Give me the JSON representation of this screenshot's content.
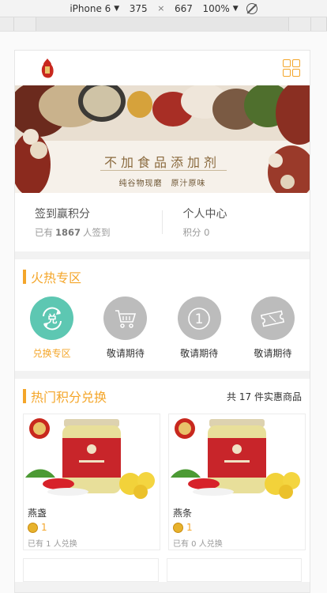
{
  "devtools": {
    "device": "iPhone 6",
    "width": "375",
    "height": "667",
    "zoom": "100%"
  },
  "banner": {
    "slogan": "不加食品添加剂",
    "subtitle": "纯谷物现磨　原汁原味"
  },
  "stats": {
    "checkin_title": "签到赢积分",
    "checkin_prefix": "已有",
    "checkin_count": "1867",
    "checkin_suffix": "人签到",
    "profile_title": "个人中心",
    "points_label": "积分",
    "points_value": "0"
  },
  "hot_zone": {
    "title": "火热专区",
    "items": [
      {
        "label": "兑换专区",
        "icon": "exchange-icon",
        "active": true
      },
      {
        "label": "敬请期待",
        "icon": "cart-icon",
        "active": false
      },
      {
        "label": "敬请期待",
        "icon": "number-one-icon",
        "active": false
      },
      {
        "label": "敬请期待",
        "icon": "ticket-icon",
        "active": false
      }
    ]
  },
  "exchange": {
    "title": "热门积分兑换",
    "total_prefix": "共",
    "total_count": "17",
    "total_suffix": "件实惠商品",
    "products": [
      {
        "name": "燕盏",
        "price": "1",
        "count_text": "已有 1 人兑换"
      },
      {
        "name": "燕条",
        "price": "1",
        "count_text": "已有 0 人兑换"
      }
    ]
  },
  "colors": {
    "accent": "#f4a62a",
    "active_icon": "#5dc7b2",
    "inactive_icon": "#bcbcbc"
  }
}
